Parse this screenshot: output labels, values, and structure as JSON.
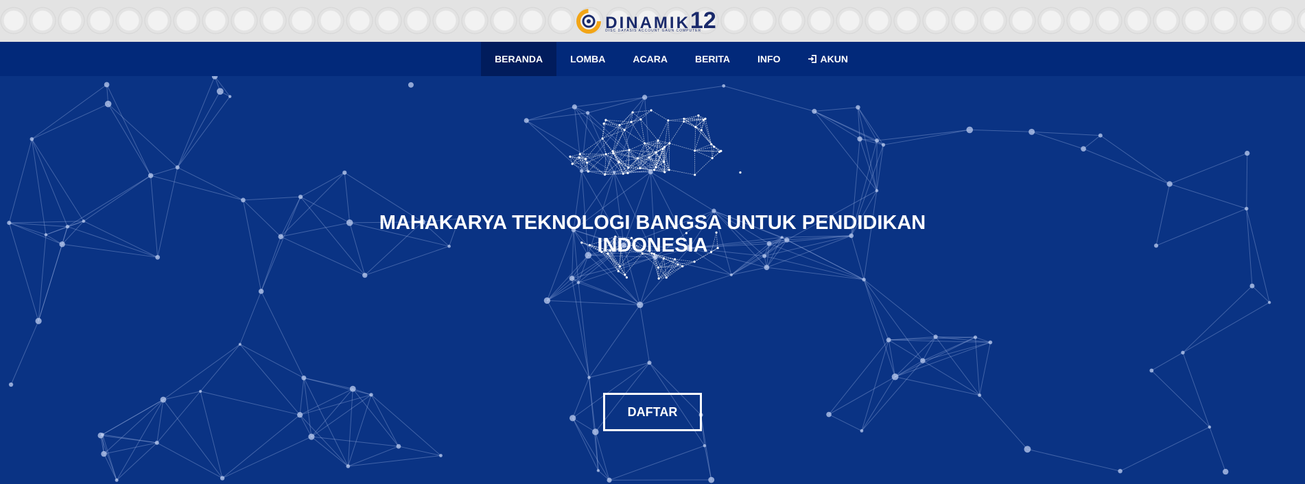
{
  "brand": {
    "name": "DINAMIK",
    "number": "12",
    "tagline": "DISC DAYASIS ACCOUNT GAUN COMPUTER",
    "colors": {
      "primary": "#1a2a6b",
      "accent": "#f2a516"
    }
  },
  "nav": {
    "items": [
      {
        "label": "BERANDA",
        "active": true
      },
      {
        "label": "LOMBA",
        "active": false
      },
      {
        "label": "ACARA",
        "active": false
      },
      {
        "label": "BERITA",
        "active": false
      },
      {
        "label": "INFO",
        "active": false
      },
      {
        "label": "AKUN",
        "active": false,
        "icon": "login-icon"
      }
    ]
  },
  "hero": {
    "headline_line1": "MAHAKARYA TEKNOLOGI BANGSA UNTUK PENDIDIKAN",
    "headline_line2": "INDONESIA",
    "cta_label": "DAFTAR",
    "background_color": "#0a3384"
  }
}
